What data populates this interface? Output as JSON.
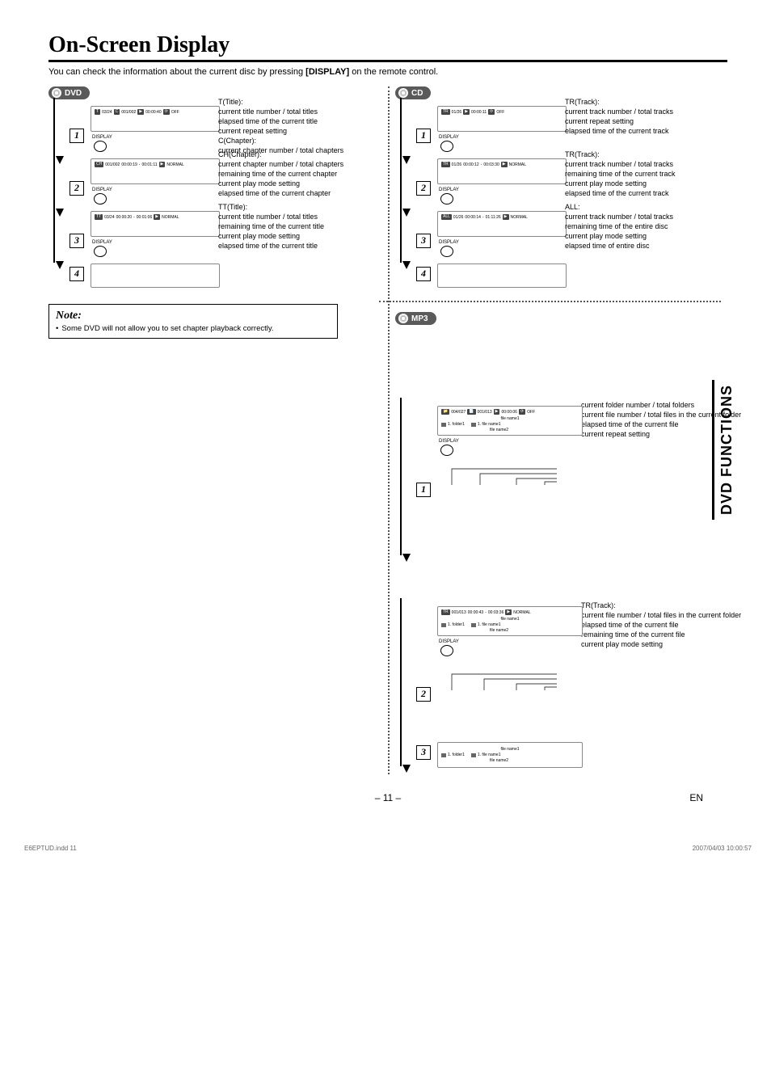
{
  "title": "On-Screen Display",
  "intro_pre": "You can check the information about the current disc by pressing ",
  "intro_bold": "[DISPLAY]",
  "intro_post": " on the remote control.",
  "display_label": "DISPLAY",
  "side_tab": "DVD FUNCTIONS",
  "page_number": "– 11 –",
  "page_lang": "EN",
  "print_left": "E6EPTUD.indd   11",
  "print_right": "2007/04/03   10:00:57",
  "note": {
    "title": "Note:",
    "body": "Some DVD will not allow you to set chapter playback correctly."
  },
  "badges": {
    "dvd": "DVD",
    "cd": "CD",
    "mp3": "MP3"
  },
  "dvd": {
    "step1": {
      "num": "1",
      "osd": {
        "t_chip": "T",
        "t": "03/24",
        "c_chip": "C",
        "c": "001/002",
        "time_chip": "",
        "time": "00:00:40",
        "rep_chip": "",
        "rep": "OFF"
      },
      "callouts": [
        "T(Title):",
        "current title number / total titles",
        "elapsed time of the current title",
        "current repeat setting",
        "C(Chapter):",
        "current chapter number / total chapters"
      ]
    },
    "step2": {
      "num": "2",
      "osd": {
        "ch_chip": "CH",
        "ch": "001/002",
        "elapsed": "00:00:19",
        "sep": " - ",
        "remain": "00:01:11",
        "mode_chip": "",
        "mode": "NORMAL"
      },
      "callouts": [
        "CH(Chapter):",
        "current chapter number / total chapters",
        "remaining time of the current chapter",
        "current play mode setting",
        "elapsed time of the current chapter"
      ]
    },
    "step3": {
      "num": "3",
      "osd": {
        "tt_chip": "TT",
        "tt": "03/24",
        "elapsed": "00:00:20",
        "sep": " - ",
        "remain": "00:01:06",
        "mode_chip": "",
        "mode": "NORMAL"
      },
      "callouts": [
        "TT(Title):",
        "current title number / total titles",
        "remaining time of the current title",
        "current play mode setting",
        "elapsed time of the current title"
      ]
    },
    "step4": {
      "num": "4"
    }
  },
  "cd": {
    "step1": {
      "num": "1",
      "osd": {
        "tr_chip": "TR",
        "tr": "01/26",
        "time_chip": "",
        "time": "00:00:11",
        "rep_chip": "",
        "rep": "OFF"
      },
      "callouts": [
        "TR(Track):",
        "current track number / total tracks",
        "current repeat setting",
        "elapsed time of the current track"
      ]
    },
    "step2": {
      "num": "2",
      "osd": {
        "tr_chip": "TR",
        "tr": "01/26",
        "elapsed": "00:00:12",
        "sep": " - ",
        "remain": "00:03:30",
        "mode_chip": "",
        "mode": "NORMAL"
      },
      "callouts": [
        "TR(Track):",
        "current track number / total tracks",
        "remaining time of the current track",
        "current play mode setting",
        "elapsed time of the current track"
      ]
    },
    "step3": {
      "num": "3",
      "osd": {
        "all_chip": "ALL",
        "tr": "01/26",
        "elapsed": "00:00:14",
        "sep": " - ",
        "remain": "01:11:26",
        "mode_chip": "",
        "mode": "NORMAL"
      },
      "callouts": [
        "ALL:",
        "current track number / total tracks",
        "remaining time of the entire disc",
        "current play mode setting",
        "elapsed time of entire disc"
      ]
    },
    "step4": {
      "num": "4"
    }
  },
  "mp3": {
    "step1": {
      "num": "1",
      "osd": {
        "fld_chip": "",
        "fld": "004/027",
        "file_chip": "",
        "file": "001/013",
        "time_chip": "",
        "time": "00:00:06",
        "rep_chip": "",
        "rep": "OFF",
        "fname": "file name1",
        "folder1": "1. folder1",
        "filelist1": "1. file name1",
        "filelist2": "file name2"
      },
      "callouts": [
        "current folder number / total folders",
        "current file number / total files in the current folder",
        "elapsed time of the current file",
        "current repeat setting"
      ]
    },
    "step2": {
      "num": "2",
      "osd": {
        "tr_chip": "TR",
        "tr": "001/013",
        "elapsed": "00:00:43",
        "sep": " - ",
        "remain": "00:03:36",
        "mode_chip": "",
        "mode": "NORMAL",
        "fname": "file name1",
        "folder1": "1. folder1",
        "filelist1": "1. file name1",
        "filelist2": "file name2"
      },
      "callouts": [
        "TR(Track):",
        "current file number / total files in the current folder",
        "elapsed time of the current file",
        "remaining time of the current file",
        "current play mode setting"
      ]
    },
    "step3": {
      "num": "3",
      "osd": {
        "fname": "file name1",
        "folder1": "1. folder1",
        "filelist1": "1. file name1",
        "filelist2": "file name2"
      }
    }
  }
}
